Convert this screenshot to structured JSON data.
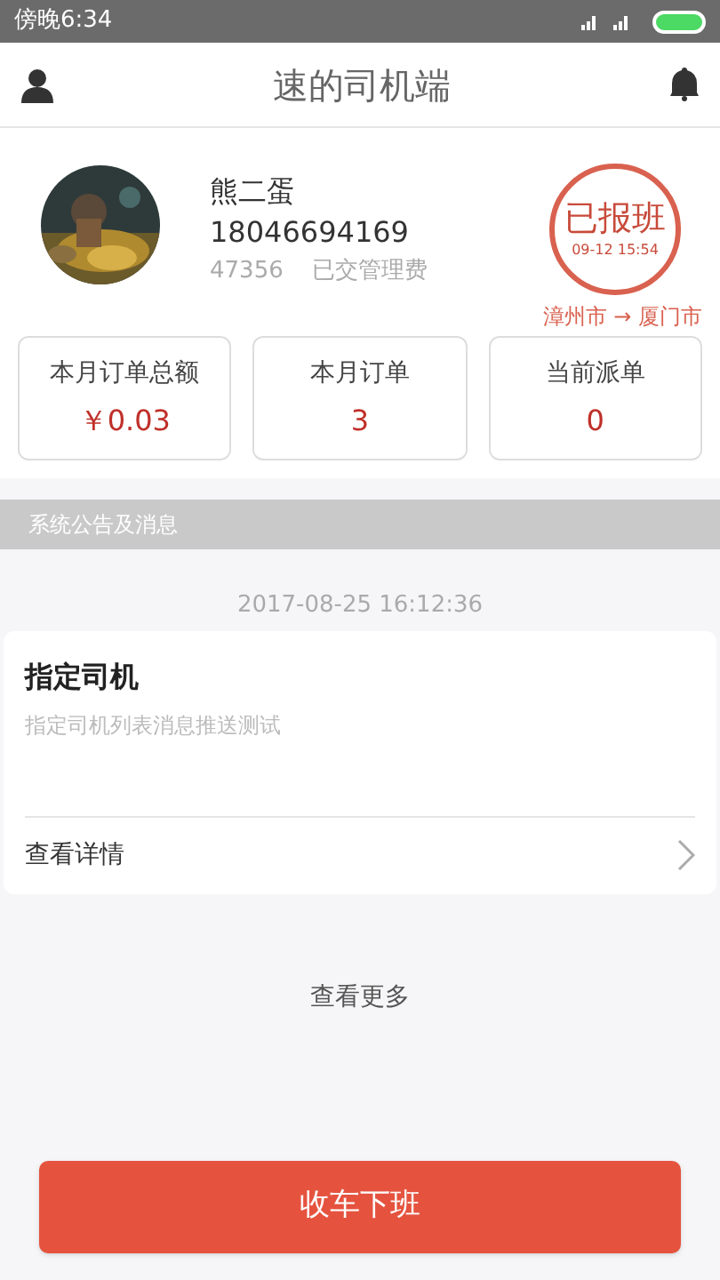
{
  "status_bar": {
    "time": "傍晚6:34"
  },
  "header": {
    "title": "速的司机端"
  },
  "profile": {
    "name": "熊二蛋",
    "phone": "18046694169",
    "id": "47356",
    "fee_status": "已交管理费",
    "stamp": {
      "label": "已报班",
      "time": "09-12 15:54"
    },
    "route": "漳州市 → 厦门市"
  },
  "stats": [
    {
      "label": "本月订单总额",
      "value": "￥0.03"
    },
    {
      "label": "本月订单",
      "value": "3"
    },
    {
      "label": "当前派单",
      "value": "0"
    }
  ],
  "section_title": "系统公告及消息",
  "messages": [
    {
      "time": "2017-08-25 16:12:36",
      "title": "指定司机",
      "body": "指定司机列表消息推送测试",
      "link": "查看详情"
    }
  ],
  "more": "查看更多",
  "action_button": "收车下班"
}
